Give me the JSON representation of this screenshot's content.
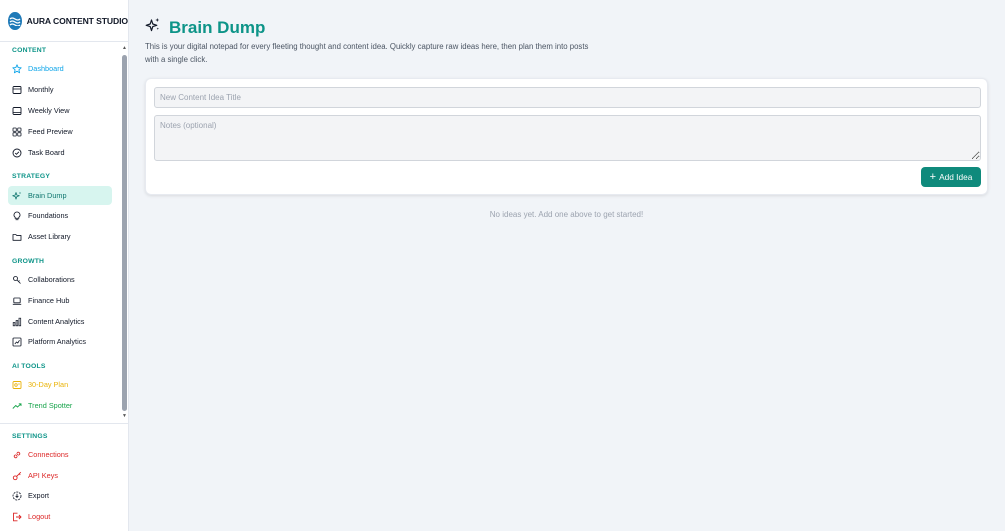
{
  "brand": {
    "title": "AURA CONTENT STUDIO"
  },
  "sidebar": {
    "sections": [
      {
        "title": "CONTENT",
        "items": [
          {
            "label": "Dashboard",
            "icon": "star-icon",
            "color": "#0ea5e9"
          },
          {
            "label": "Monthly",
            "icon": "calendar-icon",
            "color": "#111827"
          },
          {
            "label": "Weekly View",
            "icon": "calendar-week-icon",
            "color": "#111827"
          },
          {
            "label": "Feed Preview",
            "icon": "grid-icon",
            "color": "#111827"
          },
          {
            "label": "Task Board",
            "icon": "check-circle-icon",
            "color": "#111827"
          }
        ]
      },
      {
        "title": "STRATEGY",
        "items": [
          {
            "label": "Brain Dump",
            "icon": "sparkles-icon",
            "color": "#0f766e",
            "active": true
          },
          {
            "label": "Foundations",
            "icon": "lightbulb-icon",
            "color": "#111827"
          },
          {
            "label": "Asset Library",
            "icon": "folder-icon",
            "color": "#111827"
          }
        ]
      },
      {
        "title": "GROWTH",
        "items": [
          {
            "label": "Collaborations",
            "icon": "handshake-icon",
            "color": "#111827"
          },
          {
            "label": "Finance Hub",
            "icon": "laptop-icon",
            "color": "#111827"
          },
          {
            "label": "Content Analytics",
            "icon": "bar-chart-icon",
            "color": "#111827"
          },
          {
            "label": "Platform Analytics",
            "icon": "chart-box-icon",
            "color": "#111827"
          }
        ]
      },
      {
        "title": "AI TOOLS",
        "items": [
          {
            "label": "30-Day Plan",
            "icon": "plan-icon",
            "color": "#eab308"
          },
          {
            "label": "Trend Spotter",
            "icon": "trending-up-icon",
            "color": "#16a34a"
          }
        ]
      }
    ],
    "settings": {
      "title": "SETTINGS",
      "items": [
        {
          "label": "Connections",
          "icon": "link-icon",
          "color": "#dc2626"
        },
        {
          "label": "API Keys",
          "icon": "key-icon",
          "color": "#dc2626"
        },
        {
          "label": "Export",
          "icon": "export-icon",
          "color": "#111827"
        },
        {
          "label": "Logout",
          "icon": "logout-icon",
          "color": "#dc2626"
        }
      ]
    }
  },
  "main": {
    "title": "Brain Dump",
    "description": "This is your digital notepad for every fleeting thought and content idea. Quickly capture raw ideas here, then plan them into posts with a single click.",
    "form": {
      "title_placeholder": "New Content Idea Title",
      "title_value": "",
      "notes_placeholder": "Notes (optional)",
      "notes_value": "",
      "add_label": "Add Idea"
    },
    "empty_message": "No ideas yet. Add one above to get started!"
  },
  "colors": {
    "accent": "#0d9488",
    "button": "#0f8a7c",
    "active_bg": "#d7f5ef"
  }
}
